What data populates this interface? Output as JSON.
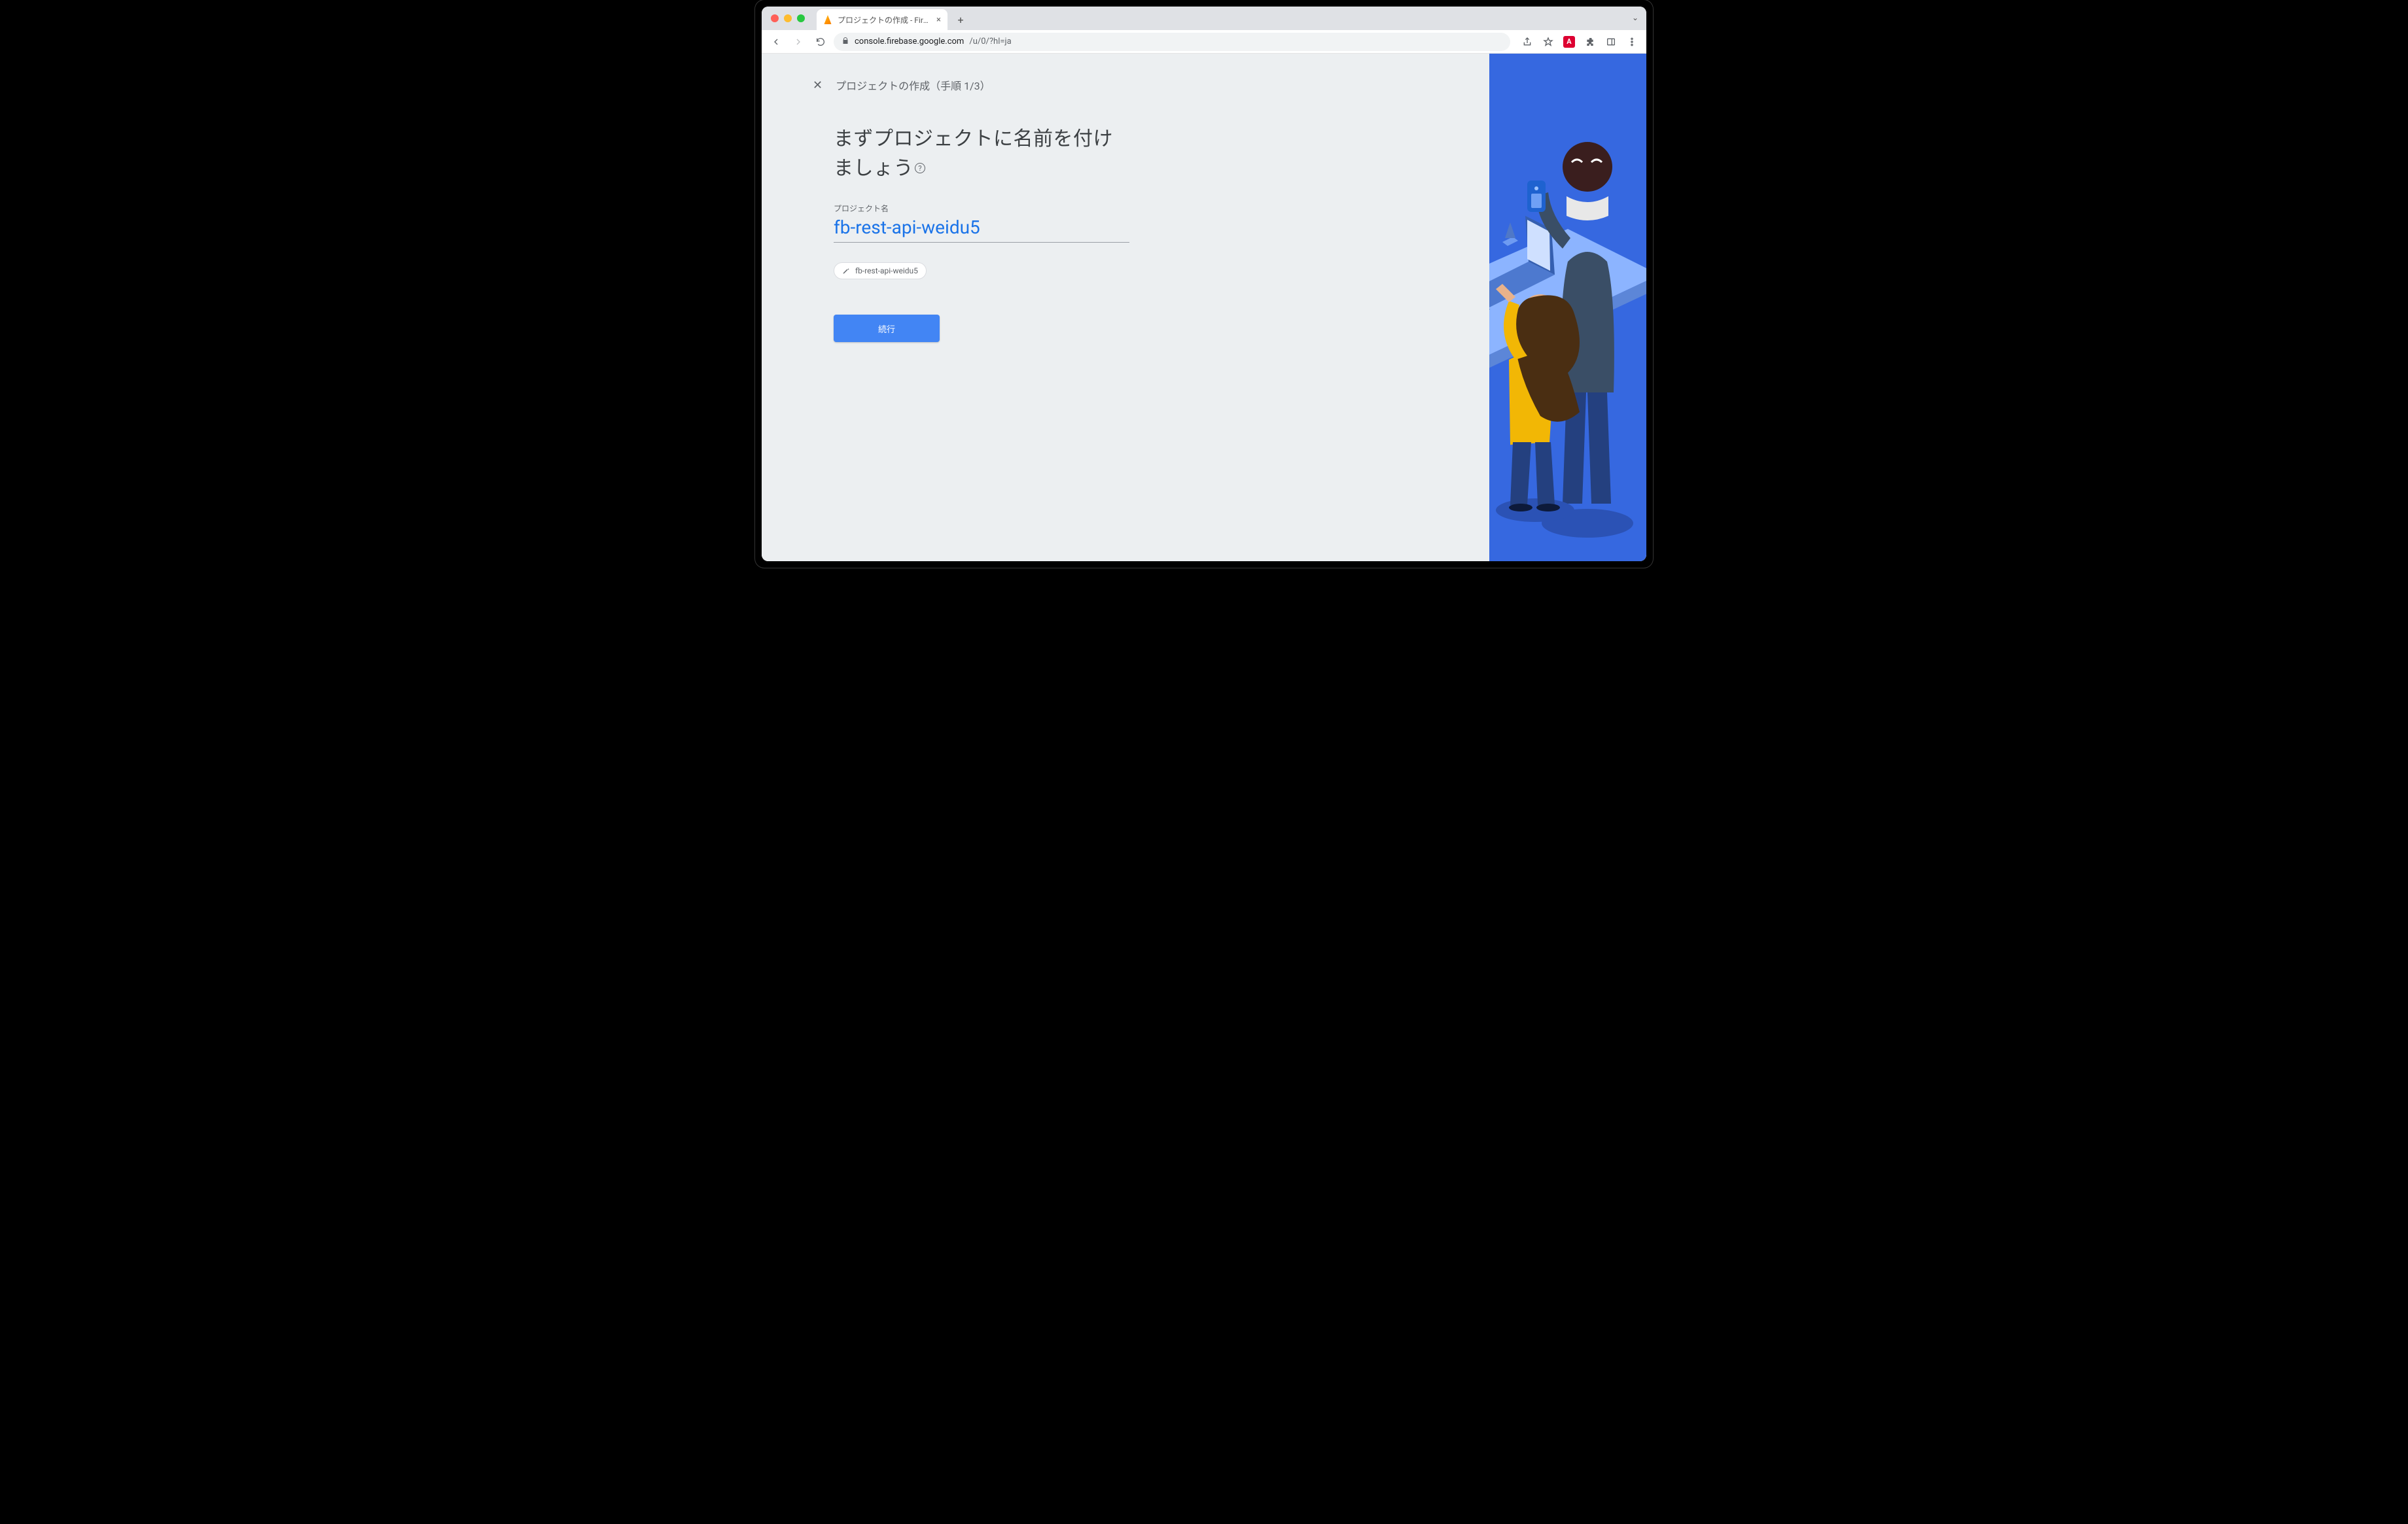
{
  "browser": {
    "tab_title": "プロジェクトの作成 - Firebase コ",
    "url_host": "console.firebase.google.com",
    "url_path": "/u/0/?hl=ja",
    "ext_badge": "A"
  },
  "header": {
    "step_label": "プロジェクトの作成（手順 1/3）"
  },
  "form": {
    "heading": "まずプロジェクトに名前を付けましょう",
    "field_label": "プロジェクト名",
    "project_name": "fb-rest-api-weidu5",
    "chip_id": "fb-rest-api-weidu5",
    "continue_label": "続行"
  }
}
